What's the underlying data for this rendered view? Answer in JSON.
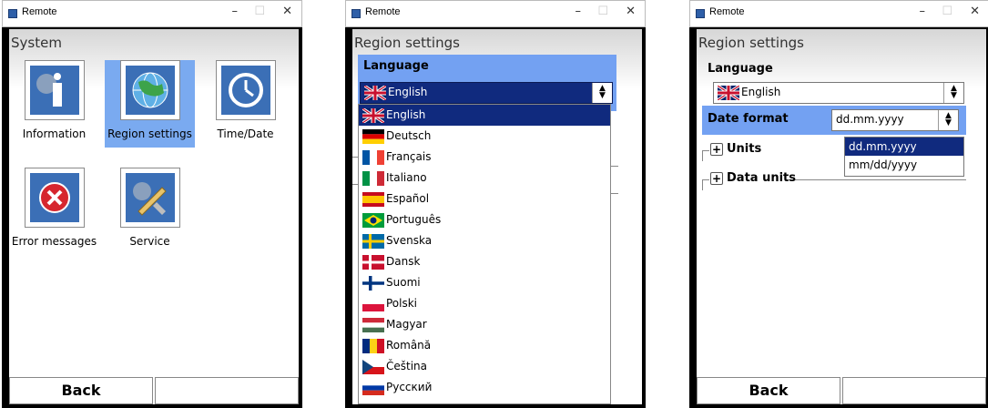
{
  "window_title": "Remote",
  "window_controls": {
    "minimize": "–",
    "maximize": "☐",
    "close": "✕"
  },
  "w1": {
    "title": "System",
    "tiles": [
      {
        "label": "Information",
        "icon": "information-icon"
      },
      {
        "label": "Region settings",
        "icon": "globe-icon",
        "selected": true
      },
      {
        "label": "Time/Date",
        "icon": "clock-icon"
      },
      {
        "label": "Error messages",
        "icon": "error-icon"
      },
      {
        "label": "Service",
        "icon": "wrench-icon"
      }
    ],
    "back": "Back"
  },
  "w2": {
    "title": "Region settings",
    "language_label": "Language",
    "selected_language": "English",
    "options": [
      "English",
      "Deutsch",
      "Français",
      "Italiano",
      "Español",
      "Português",
      "Svenska",
      "Dansk",
      "Suomi",
      "Polski",
      "Magyar",
      "Română",
      "Čeština",
      "Русский"
    ]
  },
  "w3": {
    "title": "Region settings",
    "language_label": "Language",
    "selected_language": "English",
    "date_format_label": "Date format",
    "date_format_value": "dd.mm.yyyy",
    "date_format_options": [
      "dd.mm.yyyy",
      "mm/dd/yyyy"
    ],
    "units_label": "Units",
    "data_units_label": "Data units",
    "back": "Back"
  },
  "colors": {
    "selection_blue": "#73a1f2",
    "highlight_navy": "#102a7e"
  }
}
